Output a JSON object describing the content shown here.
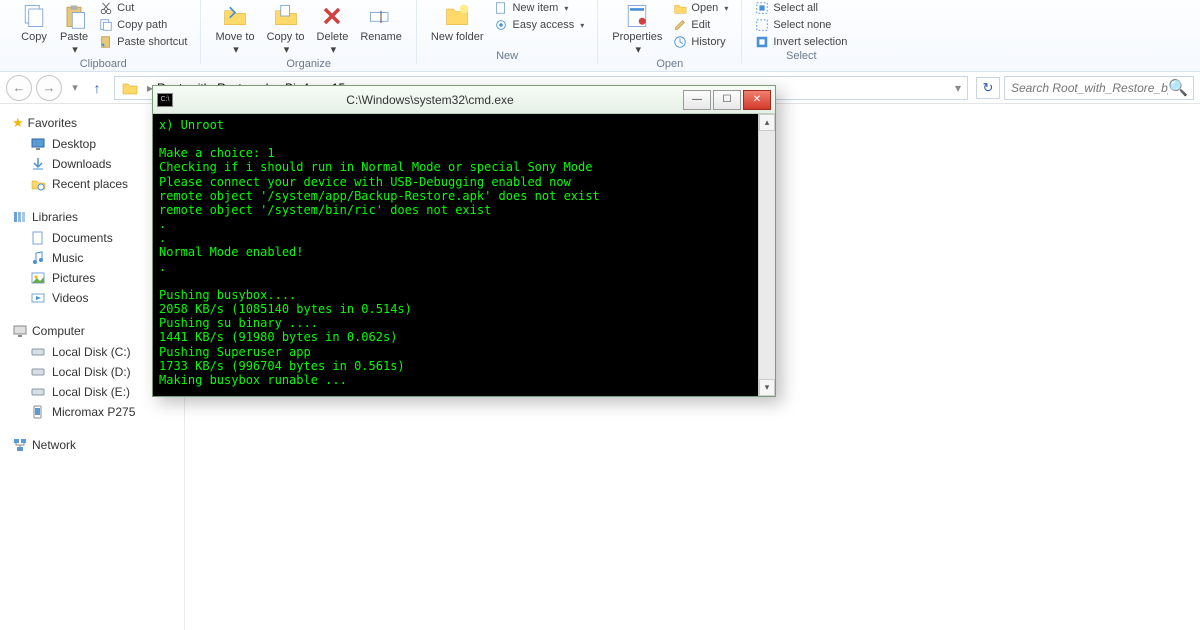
{
  "ribbon": {
    "copy": "Copy",
    "paste": "Paste",
    "cut": "Cut",
    "copy_path": "Copy path",
    "paste_shortcut": "Paste shortcut",
    "move_to": "Move to",
    "copy_to": "Copy to",
    "delete": "Delete",
    "rename": "Rename",
    "new_folder": "New folder",
    "new_item": "New item",
    "easy_access": "Easy access",
    "properties": "Properties",
    "open": "Open",
    "edit": "Edit",
    "history": "History",
    "select_all": "Select all",
    "select_none": "Select none",
    "invert_selection": "Invert selection",
    "groups": {
      "clipboard": "Clipboard",
      "organize": "Organize",
      "new": "New",
      "open": "Open",
      "select": "Select"
    }
  },
  "nav": {
    "breadcrumb": "Root_with_Restore_by_Bin4ry_v15",
    "search_placeholder": "Search Root_with_Restore_by_..."
  },
  "sidebar": {
    "favorites": "Favorites",
    "desktop": "Desktop",
    "downloads": "Downloads",
    "recent": "Recent places",
    "libraries": "Libraries",
    "documents": "Documents",
    "music": "Music",
    "pictures": "Pictures",
    "videos": "Videos",
    "computer": "Computer",
    "disk_c": "Local Disk (C:)",
    "disk_d": "Local Disk (D:)",
    "disk_e": "Local Disk (E:)",
    "micromax": "Micromax P275",
    "network": "Network"
  },
  "cmd": {
    "title": "C:\\Windows\\system32\\cmd.exe",
    "icon_text": "C:\\",
    "output": "x) Unroot\n\nMake a choice: 1\nChecking if i should run in Normal Mode or special Sony Mode\nPlease connect your device with USB-Debugging enabled now\nremote object '/system/app/Backup-Restore.apk' does not exist\nremote object '/system/bin/ric' does not exist\n.\n.\nNormal Mode enabled!\n.\n\nPushing busybox....\n2058 KB/s (1085140 bytes in 0.514s)\nPushing su binary ....\n1441 KB/s (91980 bytes in 0.062s)\nPushing Superuser app\n1733 KB/s (996704 bytes in 0.561s)\nMaking busybox runable ...\n.\nPlease look at your device and click RESTORE!\nIf all is successful i will tell you, if not this shell will run forever.\nRunning ..."
  }
}
